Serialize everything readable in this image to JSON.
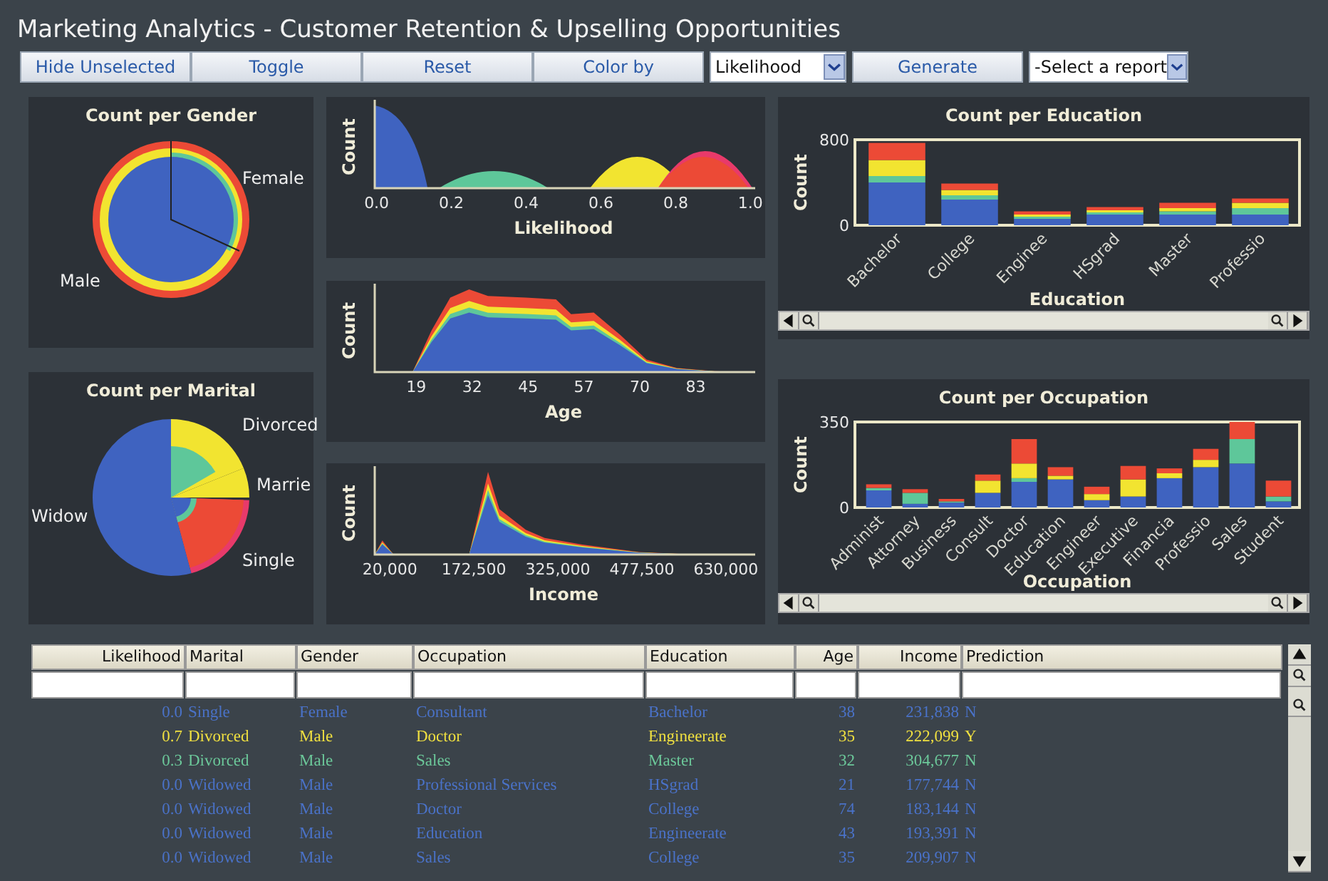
{
  "window": {
    "title": "Marketing Analytics - Customer Retention & Upselling Opportunities"
  },
  "toolbar": [
    {
      "kind": "button",
      "label": "Hide Unselected"
    },
    {
      "kind": "button",
      "label": "Toggle"
    },
    {
      "kind": "button",
      "label": "Reset"
    },
    {
      "kind": "button",
      "label": "Color by"
    },
    {
      "kind": "select",
      "value": "Likelihood"
    },
    {
      "kind": "button",
      "label": "Generate"
    },
    {
      "kind": "select",
      "value": "-Select a report"
    }
  ],
  "pies": [
    {
      "title": "Count per Gender",
      "labels": [
        "Female",
        "Male"
      ]
    },
    {
      "title": "Count per Marital",
      "labels": [
        "Divorced",
        "Marrie",
        "Widow",
        "Single"
      ]
    }
  ],
  "histograms": [
    {
      "ylabel": "Count",
      "xlabel": "Likelihood",
      "xticks": [
        "0.0",
        "0.2",
        "0.4",
        "0.6",
        "0.8",
        "1.0"
      ]
    },
    {
      "ylabel": "Count",
      "xlabel": "Age",
      "xticks": [
        "19",
        "32",
        "45",
        "57",
        "70",
        "83"
      ]
    },
    {
      "ylabel": "Count",
      "xlabel": "Income",
      "xticks": [
        "20,000",
        "172,500",
        "325,000",
        "477,500",
        "630,000"
      ]
    }
  ],
  "bar_charts": [
    {
      "chart_data": {
        "type": "bar",
        "title": "Count per Education",
        "xlabel": "Education",
        "ylabel": "Count",
        "stacked": true,
        "categories": [
          "Bachelor",
          "College",
          "Enginee",
          "HSgrad",
          "Master",
          "Professio"
        ],
        "ylim": [
          0,
          800
        ],
        "yticks": [
          0,
          800
        ],
        "series": [
          {
            "color": "#3f63c0",
            "values": [
              400,
              240,
              60,
              100,
              100,
              100
            ]
          },
          {
            "color": "#5ec79a",
            "values": [
              60,
              40,
              20,
              20,
              30,
              60
            ]
          },
          {
            "color": "#f2e430",
            "values": [
              150,
              50,
              20,
              20,
              30,
              50
            ]
          },
          {
            "color": "#ec4a36",
            "values": [
              160,
              60,
              30,
              30,
              50,
              40
            ]
          }
        ]
      }
    },
    {
      "chart_data": {
        "type": "bar",
        "title": "Count per Occupation",
        "xlabel": "Occupation",
        "ylabel": "Count",
        "stacked": true,
        "categories": [
          "Administ",
          "Attorney",
          "Business",
          "Consult",
          "Doctor",
          "Education",
          "Engineer",
          "Executive",
          "Financia",
          "Professio",
          "Sales",
          "Student"
        ],
        "ylim": [
          0,
          350
        ],
        "yticks": [
          0,
          350
        ],
        "series": [
          {
            "color": "#3f63c0",
            "values": [
              70,
              15,
              20,
              60,
              105,
              115,
              30,
              45,
              120,
              165,
              180,
              25
            ]
          },
          {
            "color": "#5ec79a",
            "values": [
              10,
              45,
              5,
              0,
              15,
              0,
              0,
              0,
              0,
              0,
              100,
              20
            ]
          },
          {
            "color": "#f2e430",
            "values": [
              0,
              0,
              0,
              50,
              60,
              15,
              25,
              70,
              20,
              30,
              0,
              0
            ]
          },
          {
            "color": "#ec4a36",
            "values": [
              15,
              15,
              10,
              25,
              100,
              35,
              30,
              55,
              20,
              45,
              70,
              65
            ]
          }
        ]
      }
    }
  ],
  "table": {
    "columns": [
      "Likelihood",
      "Marital",
      "Gender",
      "Occupation",
      "Education",
      "Age",
      "Income",
      "Prediction"
    ],
    "rows": [
      {
        "color": "#4a72c8",
        "cells": [
          "0.0",
          "Single",
          "Female",
          "Consultant",
          "Bachelor",
          "38",
          "231,838",
          "N"
        ]
      },
      {
        "color": "#f0e040",
        "cells": [
          "0.7",
          "Divorced",
          "Male",
          "Doctor",
          "Engineerate",
          "35",
          "222,099",
          "Y"
        ]
      },
      {
        "color": "#6cc89a",
        "cells": [
          "0.3",
          "Divorced",
          "Male",
          "Sales",
          "Master",
          "32",
          "304,677",
          "N"
        ]
      },
      {
        "color": "#4a72c8",
        "cells": [
          "0.0",
          "Widowed",
          "Male",
          "Professional Services",
          "HSgrad",
          "21",
          "177,744",
          "N"
        ]
      },
      {
        "color": "#4a72c8",
        "cells": [
          "0.0",
          "Widowed",
          "Male",
          "Doctor",
          "College",
          "74",
          "183,144",
          "N"
        ]
      },
      {
        "color": "#4a72c8",
        "cells": [
          "0.0",
          "Widowed",
          "Male",
          "Education",
          "Engineerate",
          "43",
          "193,391",
          "N"
        ]
      },
      {
        "color": "#4a72c8",
        "cells": [
          "0.0",
          "Widowed",
          "Male",
          "Sales",
          "College",
          "35",
          "209,907",
          "N"
        ]
      }
    ]
  }
}
